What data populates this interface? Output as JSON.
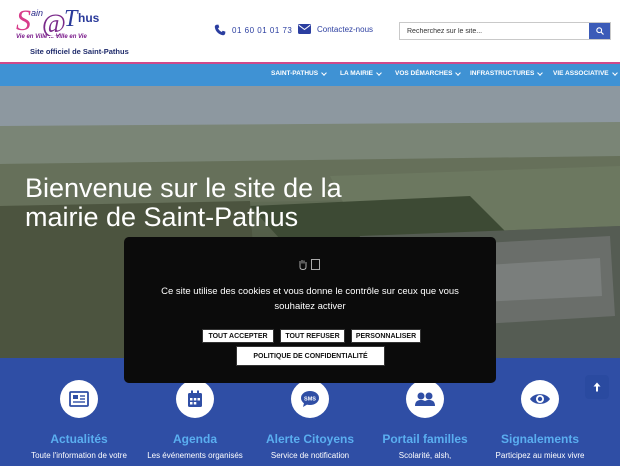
{
  "header": {
    "logo": {
      "name_top": "Saint Pathus",
      "tagline": "Vie en Ville ... Ville en Vie",
      "subtitle": "Site officiel de Saint-Pathus"
    },
    "phone": "01 60 01 01 73",
    "contact_label": "Contactez-nous",
    "search_placeholder": "Recherchez sur le site..."
  },
  "nav": {
    "items": [
      {
        "label": "SAINT-PATHUS"
      },
      {
        "label": "LA MAIRIE"
      },
      {
        "label": "VOS DÉMARCHES"
      },
      {
        "label": "INFRASTRUCTURES"
      },
      {
        "label": "VIE ASSOCIATIVE"
      }
    ]
  },
  "hero": {
    "title": "Bienvenue sur le site de la mairie de Saint-Pathus"
  },
  "cookie": {
    "text": "Ce site utilise des cookies et vous donne le contrôle sur ceux que vous souhaitez activer",
    "accept": "TOUT ACCEPTER",
    "refuse": "TOUT REFUSER",
    "customize": "PERSONNALISER",
    "policy": "POLITIQUE DE CONFIDENTIALITÉ"
  },
  "features": [
    {
      "title": "Actualités",
      "desc": "Toute l'information de votre",
      "icon": "newspaper-icon"
    },
    {
      "title": "Agenda",
      "desc": "Les événements organisés",
      "icon": "calendar-icon"
    },
    {
      "title": "Alerte Citoyens",
      "desc": "Service de notification",
      "icon": "sms-bubble-icon"
    },
    {
      "title": "Portail familles",
      "desc": "Scolarité, alsh,",
      "icon": "users-icon"
    },
    {
      "title": "Signalements",
      "desc": "Participez au mieux vivre",
      "icon": "eye-icon"
    }
  ],
  "colors": {
    "nav": "#3f92d4",
    "accent": "#d04a8a",
    "bottom": "#2f4ea5",
    "feature_title": "#5aaef0"
  }
}
